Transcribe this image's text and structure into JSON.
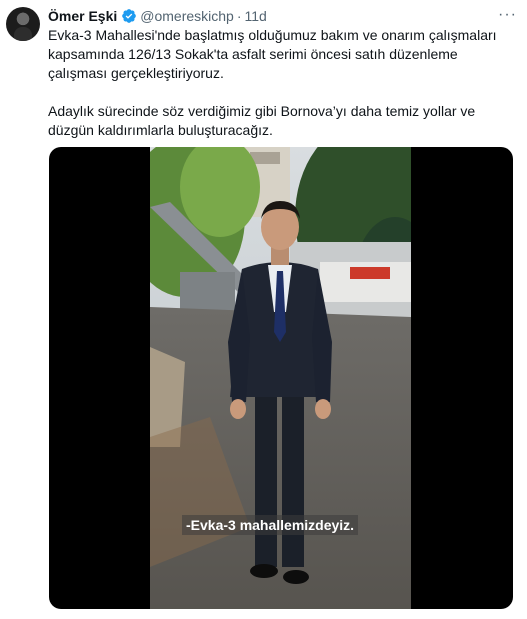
{
  "author": {
    "name": "Ömer Eşki",
    "handle": "@omereskichp",
    "separator": "·",
    "time": "11d"
  },
  "icons": {
    "avatar": "avatar-photo",
    "verified": "verified-badge-icon",
    "more": "more-options-icon"
  },
  "colors": {
    "verified_blue": "#1d9bf0",
    "secondary_text": "#536471",
    "primary_text": "#0f1419"
  },
  "more_label": "···",
  "tweet": {
    "paragraph1": "Evka-3 Mahallesi'nde başlatmış olduğumuz bakım ve onarım çalışmaları kapsamında 126/13 Sokak'ta asfalt serimi öncesi satıh düzenleme çalışması gerçekleştiriyoruz.",
    "paragraph2": "Adaylık sürecinde söz verdiğimiz gibi Bornova’yı daha temiz yollar ve düzgün kaldırımlarla buluşturacağız."
  },
  "video": {
    "subtitle": "-Evka-3 mahallemizdeyiz."
  }
}
